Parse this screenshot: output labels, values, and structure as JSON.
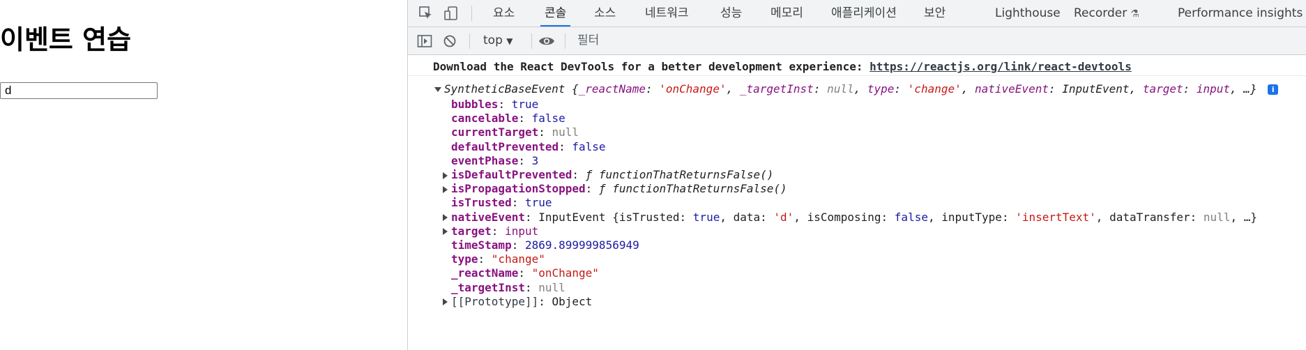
{
  "page": {
    "heading": "이벤트 연습",
    "input_value": "d"
  },
  "devtools": {
    "tabs": [
      "요소",
      "콘솔",
      "소스",
      "네트워크",
      "성능",
      "메모리",
      "애플리케이션",
      "보안",
      "Lighthouse",
      "Recorder",
      "Performance insights"
    ],
    "active_tab": "콘솔",
    "context": "top",
    "filter_placeholder": "필터",
    "accent_color": "#1a73e8"
  },
  "console": {
    "message_text": "Download the React DevTools for a better development experience: ",
    "message_link": "https://reactjs.org/link/react-devtools",
    "object_name": "SyntheticBaseEvent",
    "object_summary_parts": {
      "p1": " {",
      "k1": "_reactName",
      "v1": "'onChange'",
      "k2": "_targetInst",
      "v2": "null",
      "k3": "type",
      "v3": "'change'",
      "k4": "nativeEvent",
      "v4": "InputEvent",
      "k5": "target",
      "v5": "input",
      "tail": ", …}"
    },
    "properties": [
      {
        "key": "bubbles",
        "value": "true",
        "kind": "bool"
      },
      {
        "key": "cancelable",
        "value": "false",
        "kind": "bool"
      },
      {
        "key": "currentTarget",
        "value": "null",
        "kind": "null"
      },
      {
        "key": "defaultPrevented",
        "value": "false",
        "kind": "bool"
      },
      {
        "key": "eventPhase",
        "value": "3",
        "kind": "num"
      },
      {
        "key": "isDefaultPrevented",
        "value": "ƒ functionThatReturnsFalse()",
        "kind": "fn",
        "expandable": true
      },
      {
        "key": "isPropagationStopped",
        "value": "ƒ functionThatReturnsFalse()",
        "kind": "fn",
        "expandable": true
      },
      {
        "key": "isTrusted",
        "value": "true",
        "kind": "bool"
      },
      {
        "key": "nativeEvent",
        "value_parts": {
          "a": "InputEvent {",
          "k1": "isTrusted",
          "v1": "true",
          "k2": "data",
          "v2": "'d'",
          "k3": "isComposing",
          "v3": "false",
          "k4": "inputType",
          "v4": "'insertText'",
          "k5": "dataTransfer",
          "v5": "null",
          "tail": ", …}"
        },
        "kind": "obj",
        "expandable": true
      },
      {
        "key": "target",
        "value": "input",
        "kind": "plain",
        "expandable": true
      },
      {
        "key": "timeStamp",
        "value": "2869.899999856949",
        "kind": "num"
      },
      {
        "key": "type",
        "value": "\"change\"",
        "kind": "str"
      },
      {
        "key": "_reactName",
        "value": "\"onChange\"",
        "kind": "str"
      },
      {
        "key": "_targetInst",
        "value": "null",
        "kind": "null"
      },
      {
        "key": "[[Prototype]]",
        "value": "Object",
        "kind": "plain",
        "expandable": true,
        "faint_key": true
      }
    ]
  }
}
